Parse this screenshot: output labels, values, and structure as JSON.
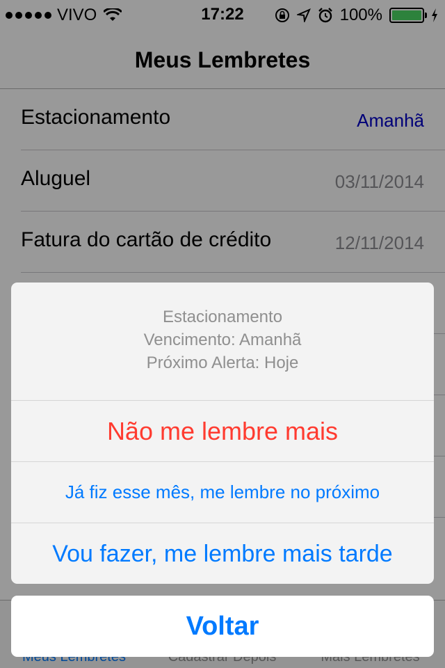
{
  "status_bar": {
    "carrier": "VIVO",
    "time": "17:22",
    "battery": "100%",
    "icons": [
      "signal-dots-icon",
      "wifi-icon",
      "orientation-lock-icon",
      "location-arrow-icon",
      "alarm-icon",
      "battery-icon",
      "charging-bolt-icon"
    ]
  },
  "nav": {
    "title": "Meus Lembretes"
  },
  "reminders": [
    {
      "title": "Estacionamento",
      "date": "Amanhã"
    },
    {
      "title": "Aluguel",
      "date": "03/11/2014"
    },
    {
      "title": "Fatura do cartão de crédito",
      "date": "12/11/2014"
    }
  ],
  "tabs": [
    {
      "label": "Meus Lembretes",
      "active": true
    },
    {
      "label": "Cadastrar Depois",
      "active": false
    },
    {
      "label": "Mais Lembretes",
      "active": false
    }
  ],
  "action_sheet": {
    "header": {
      "title": "Estacionamento",
      "due": "Vencimento: Amanhã",
      "next_alert": "Próximo Alerta: Hoje"
    },
    "buttons": {
      "stop": "Não me lembre mais",
      "next_month": "Já fiz esse mês, me lembre no próximo",
      "later": "Vou fazer, me lembre mais tarde"
    },
    "cancel": "Voltar"
  },
  "colors": {
    "accent": "#007aff",
    "destructive": "#ff3b30",
    "battery": "#4cd964",
    "soon_date": "#0000c8"
  }
}
